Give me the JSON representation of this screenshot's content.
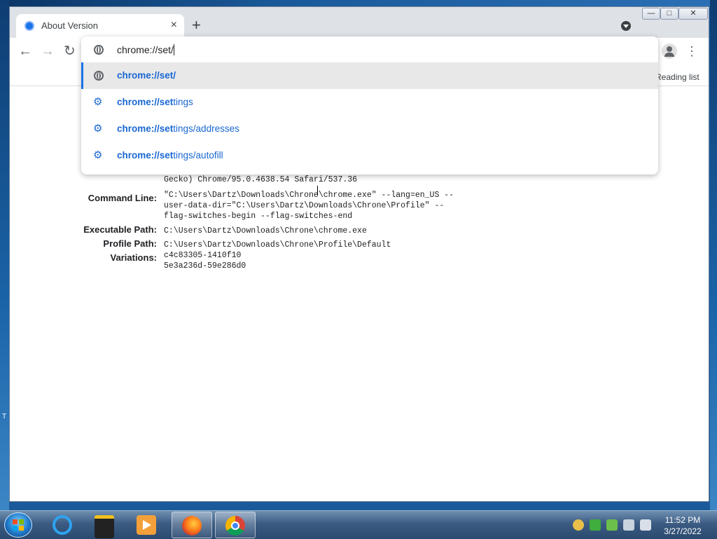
{
  "desktop": {
    "edge_text": "T"
  },
  "window": {
    "controls": {
      "minimize": "—",
      "maximize": "□",
      "close": "✕"
    }
  },
  "tab": {
    "title": "About Version",
    "close_icon": "×"
  },
  "new_tab": "+",
  "toolbar": {
    "back_icon": "←",
    "forward_icon": "→",
    "reload_icon": "↻",
    "menu_icon": "⋮"
  },
  "bookmark_bar": {
    "reading_list": "Reading list"
  },
  "omnibox": {
    "input_value": "chrome://set/",
    "suggestions": [
      {
        "bold": "chrome://set/",
        "rest": "",
        "icon": "globe-icon",
        "selected": true
      },
      {
        "bold": "chrome://set",
        "rest": "tings",
        "icon": "gear-icon",
        "selected": false
      },
      {
        "bold": "chrome://set",
        "rest": "tings/addresses",
        "icon": "gear-icon",
        "selected": false
      },
      {
        "bold": "chrome://set",
        "rest": "tings/autofill",
        "icon": "gear-icon",
        "selected": false
      }
    ]
  },
  "about": {
    "user_agent_tail": "Gecko) Chrome/95.0.4638.54 Safari/537.36",
    "rows": [
      {
        "label": "Command Line:",
        "value": "\"C:\\Users\\Dartz\\Downloads\\Chrone\\chrome.exe\" --lang=en_US --\nuser-data-dir=\"C:\\Users\\Dartz\\Downloads\\Chrone\\Profile\" --\nflag-switches-begin --flag-switches-end"
      },
      {
        "label": "Executable Path:",
        "value": "C:\\Users\\Dartz\\Downloads\\Chrone\\chrome.exe"
      },
      {
        "label": "Profile Path:",
        "value": "C:\\Users\\Dartz\\Downloads\\Chrone\\Profile\\Default"
      },
      {
        "label": "Variations:",
        "value": "c4c83305-1410f10\n5e3a236d-59e286d0"
      }
    ]
  },
  "taskbar": {
    "clock_time": "11:52 PM",
    "clock_date": "3/27/2022"
  },
  "colors": {
    "accent": "#1a73e8",
    "selected_row": "#e8e8e9",
    "taskbar": "#3b5b82"
  }
}
